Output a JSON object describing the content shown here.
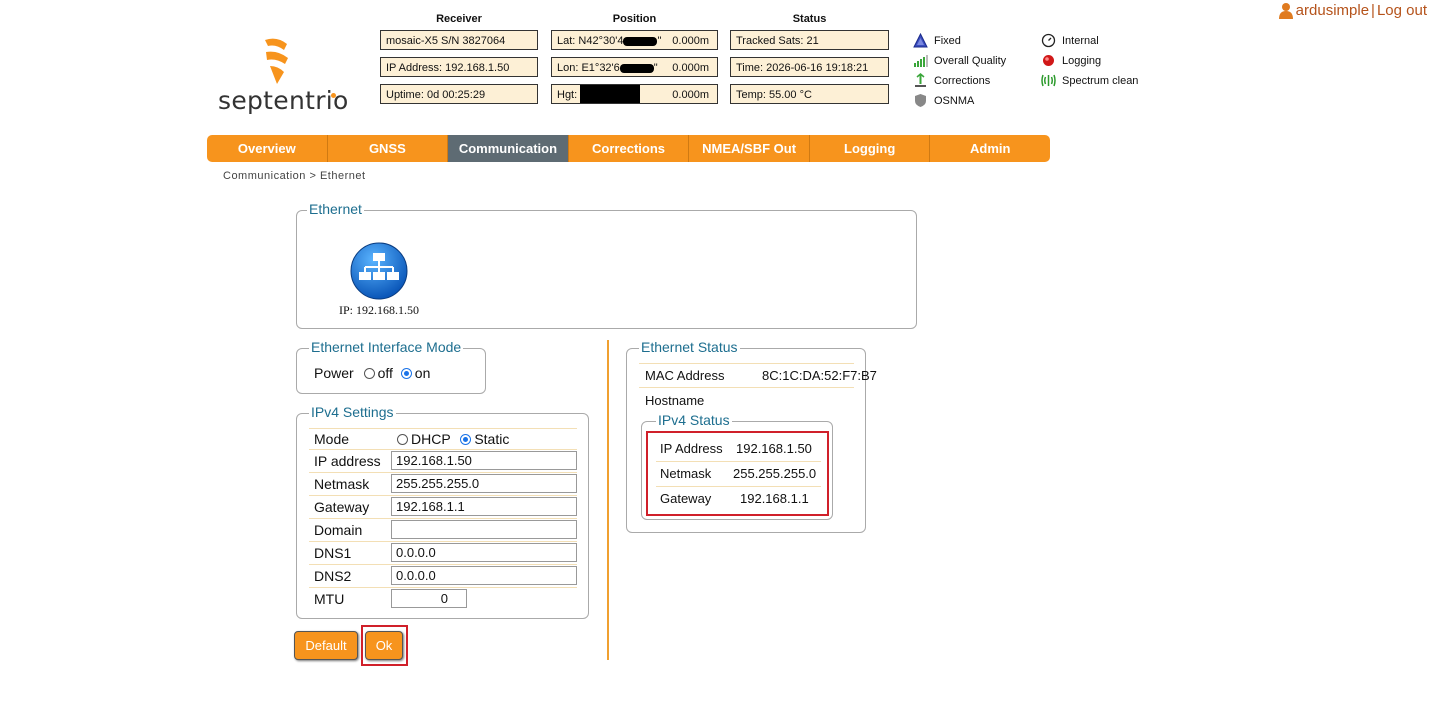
{
  "user": {
    "name": "ardusimple",
    "separator": "|",
    "logout": "Log out"
  },
  "logo": {
    "word": "septentrio"
  },
  "receiver": {
    "heading": "Receiver",
    "model": "mosaic-X5 S/N 3827064",
    "ip": "IP Address: 192.168.1.50",
    "uptime": "Uptime: 0d 00:25:29"
  },
  "position": {
    "heading": "Position",
    "lat_prefix": "Lat:  N42°30'4",
    "lat_suffix": "\"",
    "lat_value": "0.000m",
    "lon_prefix": "Lon: E1°32'6",
    "lon_suffix": "\"",
    "lon_value": "0.000m",
    "hgt_prefix": "Hgt:",
    "hgt_value": "0.000m"
  },
  "status": {
    "heading": "Status",
    "sats": "Tracked Sats: 21",
    "time": "Time: 2026-06-16 19:18:21",
    "temp": "Temp: 55.00 °C"
  },
  "indicators": {
    "fixed": "Fixed",
    "quality": "Overall Quality",
    "corrections": "Corrections",
    "osnma": "OSNMA",
    "internal": "Internal",
    "logging": "Logging",
    "spectrum": "Spectrum clean"
  },
  "nav": [
    "Overview",
    "GNSS",
    "Communication",
    "Corrections",
    "NMEA/SBF Out",
    "Logging",
    "Admin"
  ],
  "breadcrumb": "Communication > Ethernet",
  "ethernet": {
    "legend": "Ethernet",
    "ip_label": "IP: 192.168.1.50"
  },
  "mode_box": {
    "legend": "Ethernet Interface Mode",
    "power": "Power",
    "off": "off",
    "on": "on"
  },
  "ipv4": {
    "legend": "IPv4 Settings",
    "mode": "Mode",
    "dhcp": "DHCP",
    "static": "Static",
    "ip_label": "IP address",
    "ip_value": "192.168.1.50",
    "netmask_label": "Netmask",
    "netmask_value": "255.255.255.0",
    "gateway_label": "Gateway",
    "gateway_value": "192.168.1.1",
    "domain_label": "Domain",
    "domain_value": "",
    "dns1_label": "DNS1",
    "dns1_value": "0.0.0.0",
    "dns2_label": "DNS2",
    "dns2_value": "0.0.0.0",
    "mtu_label": "MTU",
    "mtu_value": "0"
  },
  "buttons": {
    "default": "Default",
    "ok": "Ok"
  },
  "eth_status": {
    "legend": "Ethernet Status",
    "mac_label": "MAC Address",
    "mac_value": "8C:1C:DA:52:F7:B7",
    "host_label": "Hostname",
    "ipv4_legend": "IPv4 Status",
    "ip_label": "IP Address",
    "ip_value": "192.168.1.50",
    "netmask_label": "Netmask",
    "netmask_value": "255.255.255.0",
    "gateway_label": "Gateway",
    "gateway_value": "192.168.1.1"
  },
  "colors": {
    "accent": "#f7941d",
    "active_tab": "#5e6b73",
    "legend": "#1d6e8f",
    "highlight": "#d0202a"
  }
}
